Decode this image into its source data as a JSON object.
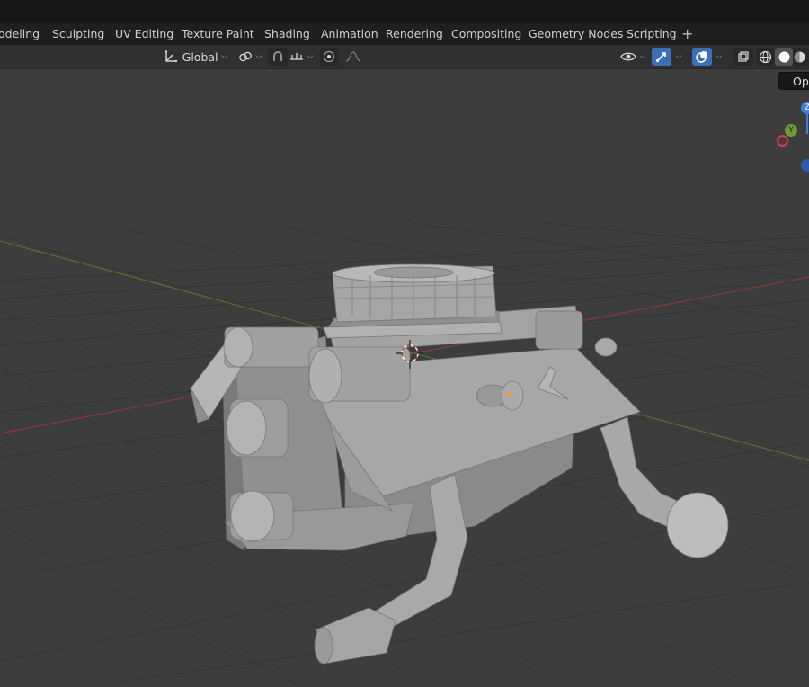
{
  "workspace_tabs": [
    "odeling",
    "Sculpting",
    "UV Editing",
    "Texture Paint",
    "Shading",
    "Animation",
    "Rendering",
    "Compositing",
    "Geometry Nodes",
    "Scripting"
  ],
  "add_workspace_label": "+",
  "toolbar": {
    "transform_orientation": "Global"
  },
  "tooltip_text": "Opt",
  "gizmo": {
    "z_label": "Z",
    "y_label": "Y"
  },
  "colors": {
    "x_axis": "#c9474f",
    "y_axis": "#6f9a3c",
    "z_axis": "#3b7fd6",
    "viewport_bg": "#3d3d3d",
    "active_button": "#3d6fb6"
  }
}
